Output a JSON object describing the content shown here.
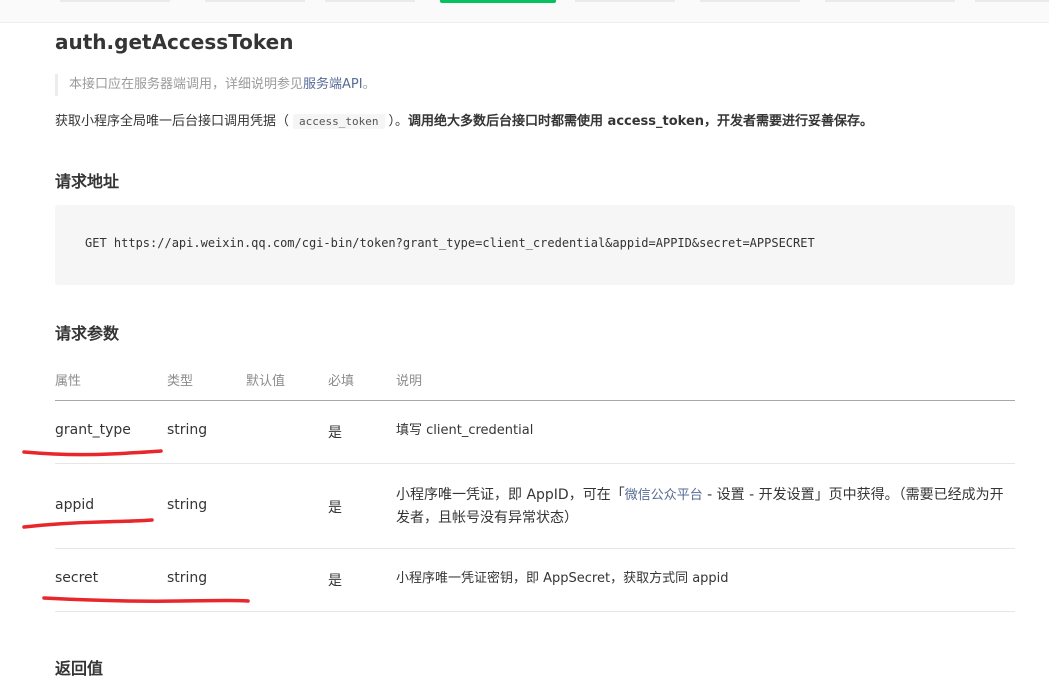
{
  "page": {
    "title": "auth.getAccessToken",
    "note_prefix": "本接口应在服务器端调用，详细说明参见",
    "note_link": "服务端API",
    "note_suffix": "。",
    "desc_prefix": "获取小程序全局唯一后台接口调用凭据（",
    "desc_code": "access_token",
    "desc_suffix": "）。",
    "desc_bold": "调用绝大多数后台接口时都需使用 access_token，开发者需要进行妥善保存。"
  },
  "request_url": {
    "heading": "请求地址",
    "code": "GET https://api.weixin.qq.com/cgi-bin/token?grant_type=client_credential&appid=APPID&secret=APPSECRET"
  },
  "params": {
    "heading": "请求参数",
    "headers": [
      "属性",
      "类型",
      "默认值",
      "必填",
      "说明"
    ],
    "rows": [
      {
        "name": "grant_type",
        "type": "string",
        "default": "",
        "required": "是",
        "desc": "填写 client_credential"
      },
      {
        "name": "appid",
        "type": "string",
        "default": "",
        "required": "是",
        "desc_pre": "小程序唯一凭证，即 AppID，可在「",
        "desc_link": "微信公众平台",
        "desc_post": " - 设置 - 开发设置」页中获得。（需要已经成为开发者，且帐号没有异常状态）"
      },
      {
        "name": "secret",
        "type": "string",
        "default": "",
        "required": "是",
        "desc": "小程序唯一凭证密钥，即 AppSecret，获取方式同 appid"
      }
    ]
  },
  "return": {
    "heading": "返回值"
  },
  "colors": {
    "accent": "#07c160",
    "link": "#576b95",
    "annotation": "#e8262c"
  }
}
